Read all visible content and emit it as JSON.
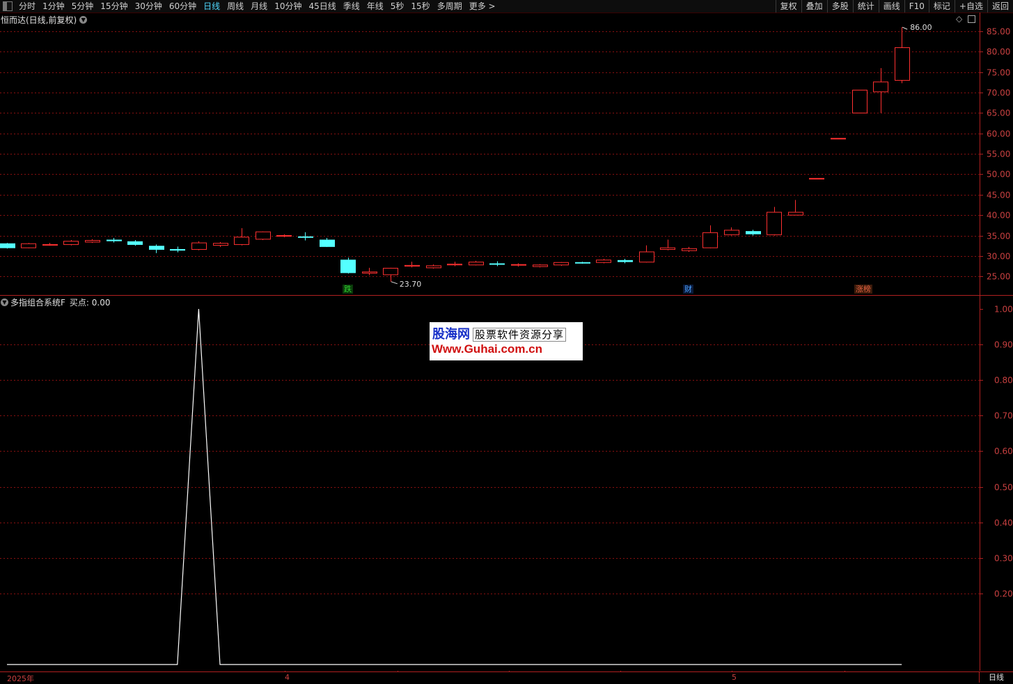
{
  "toolbar": {
    "periods": [
      "分时",
      "1分钟",
      "5分钟",
      "15分钟",
      "30分钟",
      "60分钟",
      "日线",
      "周线",
      "月线",
      "10分钟",
      "45日线",
      "季线",
      "年线",
      "5秒",
      "15秒",
      "多周期",
      "更多 >"
    ],
    "active_period": "日线",
    "right_buttons": [
      "复权",
      "叠加",
      "多股",
      "统计",
      "画线",
      "F10",
      "标记",
      "+自选",
      "返回"
    ]
  },
  "main_pane": {
    "title": "恒而达(日线,前复权)",
    "y_ticks": [
      "85.00",
      "80.00",
      "75.00",
      "70.00",
      "65.00",
      "60.00",
      "55.00",
      "50.00",
      "45.00",
      "40.00",
      "35.00",
      "30.00",
      "25.00"
    ],
    "max_label": "86.00",
    "min_label": "23.70",
    "badges": [
      {
        "text": "跌",
        "color": "#30d030"
      },
      {
        "text": "财",
        "color": "#4aa0ff"
      },
      {
        "text": "涨榜",
        "color": "#e06040"
      }
    ]
  },
  "indicator_pane": {
    "title": "多指组合系统F",
    "value_label": "买点: 0.00",
    "y_ticks": [
      "1.00",
      "0.90",
      "0.80",
      "0.70",
      "0.60",
      "0.50",
      "0.40",
      "0.30",
      "0.20"
    ]
  },
  "watermark": {
    "line1_a": "股海网",
    "line1_b": "股票软件资源分享",
    "line2": "Www.Guhai.com.cn"
  },
  "bottom": {
    "dates": [
      "2025年",
      "4",
      "5"
    ],
    "period_button": "日线"
  },
  "colors": {
    "up": "#ff3030",
    "down": "#54ffff",
    "grid": "#8a1010",
    "axis": "#b02020"
  },
  "chart_data": {
    "type": "candlestick",
    "ylim": [
      21.5,
      88
    ],
    "candles": [
      {
        "o": 33.0,
        "c": 32.0,
        "h": 33.2,
        "l": 31.8
      },
      {
        "o": 32.0,
        "c": 33.0,
        "h": 33.2,
        "l": 31.9
      },
      {
        "o": 32.8,
        "c": 32.8,
        "h": 33.2,
        "l": 32.5
      },
      {
        "o": 32.8,
        "c": 33.6,
        "h": 33.9,
        "l": 32.6
      },
      {
        "o": 33.4,
        "c": 33.8,
        "h": 34.1,
        "l": 33.2
      },
      {
        "o": 33.9,
        "c": 33.7,
        "h": 34.4,
        "l": 33.3
      },
      {
        "o": 33.5,
        "c": 32.8,
        "h": 33.9,
        "l": 32.5
      },
      {
        "o": 32.4,
        "c": 31.6,
        "h": 32.8,
        "l": 30.7
      },
      {
        "o": 31.6,
        "c": 31.4,
        "h": 32.3,
        "l": 30.9
      },
      {
        "o": 31.6,
        "c": 33.2,
        "h": 33.6,
        "l": 31.4
      },
      {
        "o": 32.6,
        "c": 33.1,
        "h": 33.4,
        "l": 32.2
      },
      {
        "o": 32.8,
        "c": 34.6,
        "h": 36.8,
        "l": 32.6
      },
      {
        "o": 34.1,
        "c": 35.9,
        "h": 36.0,
        "l": 33.9
      },
      {
        "o": 35.0,
        "c": 35.0,
        "h": 35.3,
        "l": 34.6
      },
      {
        "o": 34.7,
        "c": 34.6,
        "h": 35.8,
        "l": 33.8
      },
      {
        "o": 33.9,
        "c": 32.3,
        "h": 34.4,
        "l": 32.2
      },
      {
        "o": 29.0,
        "c": 25.9,
        "h": 29.6,
        "l": 25.7
      },
      {
        "o": 25.8,
        "c": 26.1,
        "h": 27.1,
        "l": 25.3
      },
      {
        "o": 25.4,
        "c": 27.0,
        "h": 27.1,
        "l": 23.7
      },
      {
        "o": 27.5,
        "c": 27.7,
        "h": 28.6,
        "l": 27.2
      },
      {
        "o": 27.1,
        "c": 27.6,
        "h": 27.9,
        "l": 26.9
      },
      {
        "o": 27.8,
        "c": 28.0,
        "h": 28.6,
        "l": 27.5
      },
      {
        "o": 27.8,
        "c": 28.5,
        "h": 28.8,
        "l": 27.7
      },
      {
        "o": 28.1,
        "c": 28.0,
        "h": 28.7,
        "l": 27.5
      },
      {
        "o": 27.8,
        "c": 27.9,
        "h": 28.2,
        "l": 27.4
      },
      {
        "o": 27.4,
        "c": 27.8,
        "h": 28.0,
        "l": 27.2
      },
      {
        "o": 27.8,
        "c": 28.4,
        "h": 28.5,
        "l": 27.6
      },
      {
        "o": 28.4,
        "c": 28.3,
        "h": 28.6,
        "l": 28.1
      },
      {
        "o": 28.4,
        "c": 29.0,
        "h": 29.3,
        "l": 28.2
      },
      {
        "o": 28.9,
        "c": 28.6,
        "h": 29.3,
        "l": 28.2
      },
      {
        "o": 28.5,
        "c": 31.0,
        "h": 32.6,
        "l": 28.4
      },
      {
        "o": 31.6,
        "c": 32.0,
        "h": 34.0,
        "l": 31.4
      },
      {
        "o": 31.3,
        "c": 31.8,
        "h": 32.2,
        "l": 31.0
      },
      {
        "o": 32.0,
        "c": 35.7,
        "h": 37.5,
        "l": 31.9
      },
      {
        "o": 35.2,
        "c": 36.3,
        "h": 37.0,
        "l": 35.0
      },
      {
        "o": 36.0,
        "c": 35.4,
        "h": 36.4,
        "l": 35.0
      },
      {
        "o": 35.2,
        "c": 40.7,
        "h": 42.0,
        "l": 35.0
      },
      {
        "o": 40.0,
        "c": 40.7,
        "h": 43.7,
        "l": 40.0
      },
      {
        "o": 49.0,
        "c": 49.0,
        "h": 49.0,
        "l": 49.0
      },
      {
        "o": 58.8,
        "c": 58.8,
        "h": 58.8,
        "l": 58.8
      },
      {
        "o": 65.0,
        "c": 70.6,
        "h": 70.6,
        "l": 65.0
      },
      {
        "o": 70.2,
        "c": 72.6,
        "h": 76.0,
        "l": 65.0
      },
      {
        "o": 73.0,
        "c": 81.0,
        "h": 86.0,
        "l": 72.3
      }
    ],
    "indicator": {
      "name": "多指组合系统F",
      "ylim": [
        0.0,
        1.0
      ],
      "values": [
        0,
        0,
        0,
        0,
        0,
        0,
        0,
        0,
        0,
        1,
        0,
        0,
        0,
        0,
        0,
        0,
        0,
        0,
        0,
        0,
        0,
        0,
        0,
        0,
        0,
        0,
        0,
        0,
        0,
        0,
        0,
        0,
        0,
        0,
        0,
        0,
        0,
        0,
        0,
        0,
        0,
        0,
        0
      ]
    }
  }
}
